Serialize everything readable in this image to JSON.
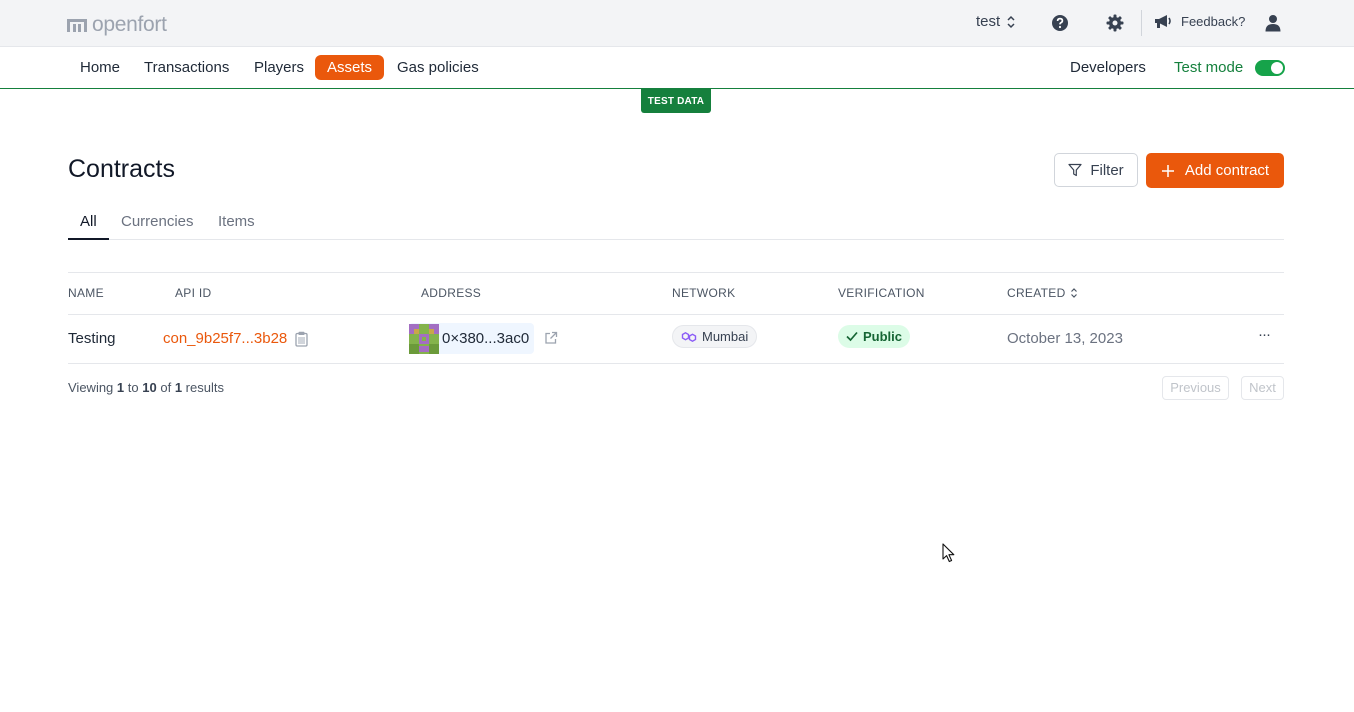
{
  "app": {
    "logo_text": "openfort"
  },
  "topbar": {
    "project_name": "test",
    "feedback_label": "Feedback?",
    "icons": [
      "help-icon",
      "gear-icon",
      "megaphone-icon",
      "user-icon"
    ]
  },
  "nav": {
    "items": [
      {
        "label": "Home"
      },
      {
        "label": "Transactions"
      },
      {
        "label": "Players"
      },
      {
        "label": "Assets",
        "active": true
      },
      {
        "label": "Gas policies"
      }
    ],
    "developers_label": "Developers",
    "test_mode_label": "Test mode",
    "test_mode_on": true
  },
  "banner": {
    "label": "TEST DATA"
  },
  "page": {
    "title": "Contracts",
    "filter_label": "Filter",
    "add_label": "Add contract"
  },
  "tabs": [
    {
      "label": "All",
      "active": true
    },
    {
      "label": "Currencies"
    },
    {
      "label": "Items"
    }
  ],
  "table": {
    "columns": [
      "NAME",
      "API ID",
      "ADDRESS",
      "NETWORK",
      "VERIFICATION",
      "CREATED"
    ],
    "rows": [
      {
        "name": "Testing",
        "api_id": "con_9b25f7...3b28",
        "address": "0×380...3ac0",
        "network": "Mumbai",
        "verification": "Public",
        "created": "October 13, 2023",
        "menu": "···"
      }
    ]
  },
  "pagination": {
    "prefix": "Viewing",
    "from": "1",
    "to_word": "to",
    "to": "10",
    "of_word": "of",
    "total": "1",
    "suffix": "results",
    "previous_label": "Previous",
    "next_label": "Next"
  },
  "colors": {
    "accent": "#ea580c",
    "test_green": "#15803d",
    "topbar_bg": "#f3f4f6"
  }
}
